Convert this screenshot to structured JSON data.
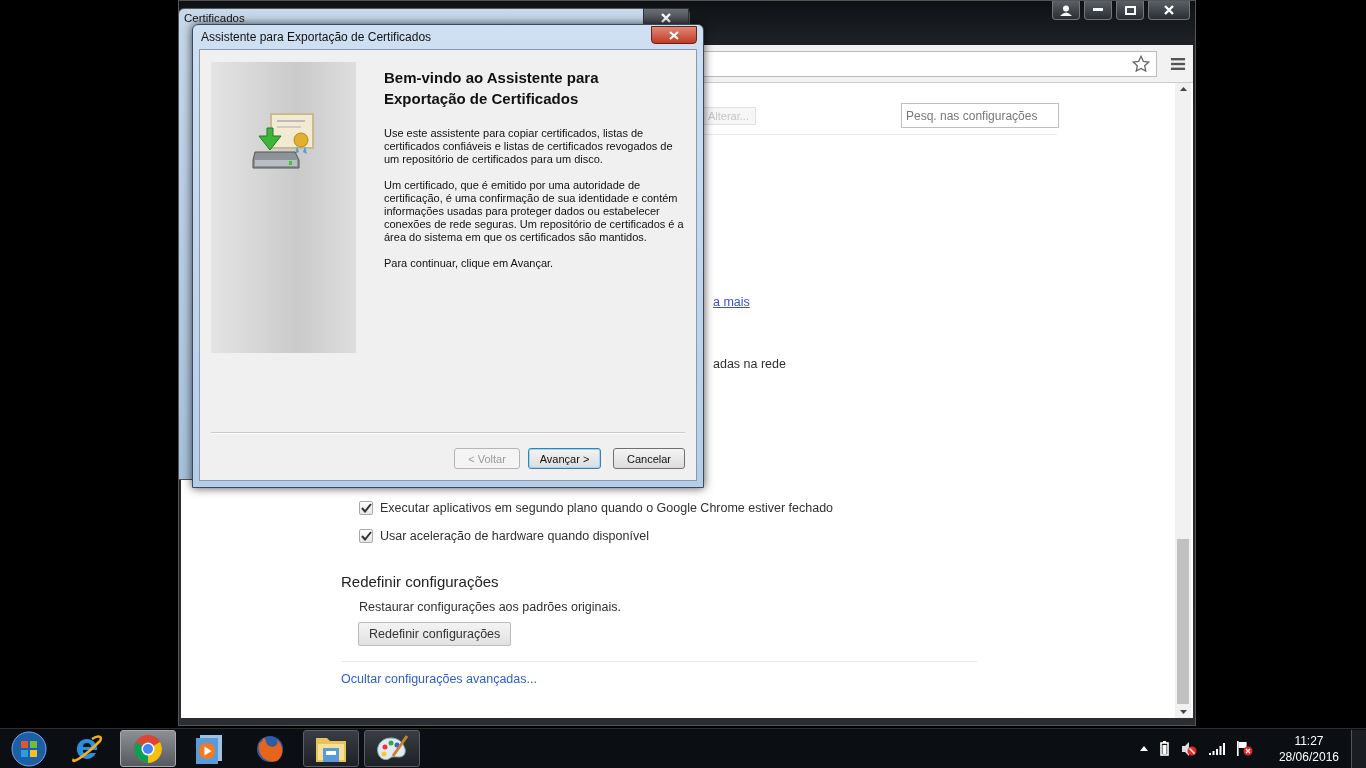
{
  "certificates_window": {
    "title": "Certificados"
  },
  "browser": {
    "search": {
      "placeholder": "Pesq. nas configurações"
    },
    "partial_button": {
      "label": "Alterar...",
      "disabled": true
    },
    "partial_link": "a mais",
    "partial_text": "adas na rede",
    "options": [
      {
        "label": "Executar aplicativos em segundo plano quando o Google Chrome estiver fechado",
        "checked": true
      },
      {
        "label": "Usar aceleração de hardware quando disponível",
        "checked": true
      }
    ],
    "reset_section": {
      "heading": "Redefinir configurações",
      "description": "Restaurar configurações aos padrões originais.",
      "button": "Redefinir configurações"
    },
    "hide_advanced_link": "Ocultar configurações avançadas..."
  },
  "wizard": {
    "title": "Assistente para Exportação de Certificados",
    "heading": "Bem-vindo ao Assistente para Exportação de Certificados",
    "paragraphs": [
      "Use este assistente para copiar certificados, listas de certificados confiáveis e listas de certificados revogados de um repositório de certificados para um disco.",
      "Um certificado, que é emitido por uma autoridade de certificação, é uma confirmação de sua identidade e contém informações usadas para proteger dados ou estabelecer conexões de rede seguras. Um repositório de certificados é a área do sistema em que os certificados são mantidos.",
      "Para continuar, clique em Avançar."
    ],
    "buttons": [
      {
        "label": "< Voltar",
        "disabled": true,
        "default": false
      },
      {
        "label": "Avançar >",
        "disabled": false,
        "default": true
      },
      {
        "label": "Cancelar",
        "disabled": false,
        "default": false
      }
    ]
  },
  "taskbar": {
    "apps": [
      {
        "kind": "e-letter",
        "running": false,
        "selected": false
      },
      {
        "kind": "round-browser",
        "running": true,
        "selected": true
      },
      {
        "kind": "media",
        "running": false,
        "selected": false
      },
      {
        "kind": "fox",
        "running": false,
        "selected": false
      },
      {
        "kind": "folder",
        "running": true,
        "selected": false
      },
      {
        "kind": "palette",
        "running": true,
        "selected": false
      }
    ],
    "clock": {
      "time": "11:27",
      "date": "28/06/2016"
    }
  }
}
